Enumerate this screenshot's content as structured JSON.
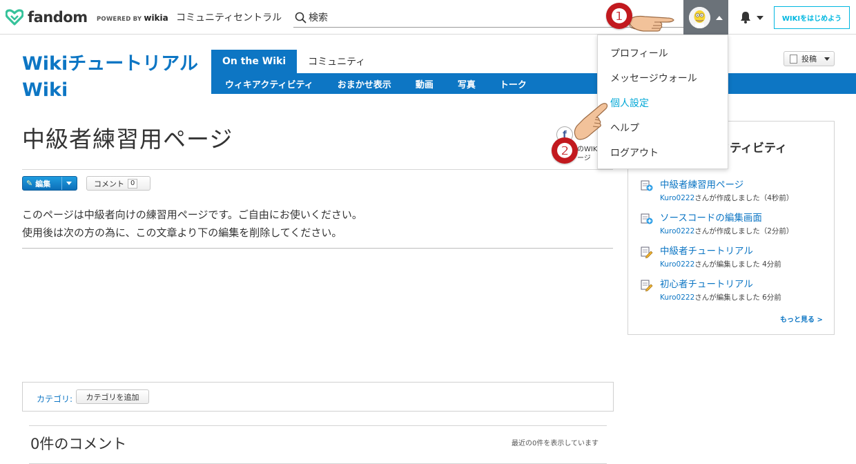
{
  "topbar": {
    "logo_text": "fandom",
    "powered_prefix": "POWERED BY",
    "powered_brand": "wikia",
    "community_link": "コミュニティセントラル",
    "search_placeholder": "検索",
    "start_wiki_label": "WIKIをはじめよう"
  },
  "wiki": {
    "name": "Wikiチュートリアル Wiki",
    "tabs": [
      {
        "label": "On the Wiki",
        "active": true
      },
      {
        "label": "コミュニティ",
        "active": false
      }
    ],
    "subnav": [
      "ウィキアクティビティ",
      "おまかせ表示",
      "動画",
      "写真",
      "トーク"
    ],
    "contribute_label": "投稿"
  },
  "user_menu": {
    "items": [
      {
        "label": "プロフィール",
        "highlight": false
      },
      {
        "label": "メッセージウォール",
        "highlight": false
      },
      {
        "label": "個人設定",
        "highlight": true
      },
      {
        "label": "ヘルプ",
        "highlight": false
      },
      {
        "label": "ログアウト",
        "highlight": false
      }
    ]
  },
  "article": {
    "title": "中級者練習用ページ",
    "share_fragment_1": "のWIKI",
    "share_fragment_2": "ージ",
    "edit_label": "編集",
    "comment_label": "コメント",
    "comment_count": "0",
    "body_line_1": "このページは中級者向けの練習用ページです。ご自由にお使いください。",
    "body_line_2": "使用後は次の方の為に、この文章より下の編集を削除してください。",
    "category_label": "カテゴリ:",
    "add_category_label": "カテゴリを追加"
  },
  "comments": {
    "title": "0件のコメント",
    "meta": "最近の0件を表示しています"
  },
  "rail": {
    "title": "クティビティ",
    "activities": [
      {
        "title": "中級者練習用ページ",
        "user": "Kuro0222",
        "action": "さんが作成しました（4秒前）",
        "type": "new"
      },
      {
        "title": "ソースコードの編集画面",
        "user": "Kuro0222",
        "action": "さんが作成しました（2分前）",
        "type": "new"
      },
      {
        "title": "中級者チュートリアル",
        "user": "Kuro0222",
        "action": "さんが編集しました 4分前",
        "type": "edit"
      },
      {
        "title": "初心者チュートリアル",
        "user": "Kuro0222",
        "action": "さんが編集しました 6分前",
        "type": "edit"
      }
    ],
    "more_label": "もっと見る >"
  },
  "annotations": {
    "step1": "❶",
    "step2": "❷"
  },
  "colors": {
    "wiki_blue": "#0d76c4",
    "fandom_teal": "#00b7e0",
    "menu_highlight": "#00a7d6",
    "badge_red": "#c2191e",
    "avatar_bg": "#6b7279"
  }
}
